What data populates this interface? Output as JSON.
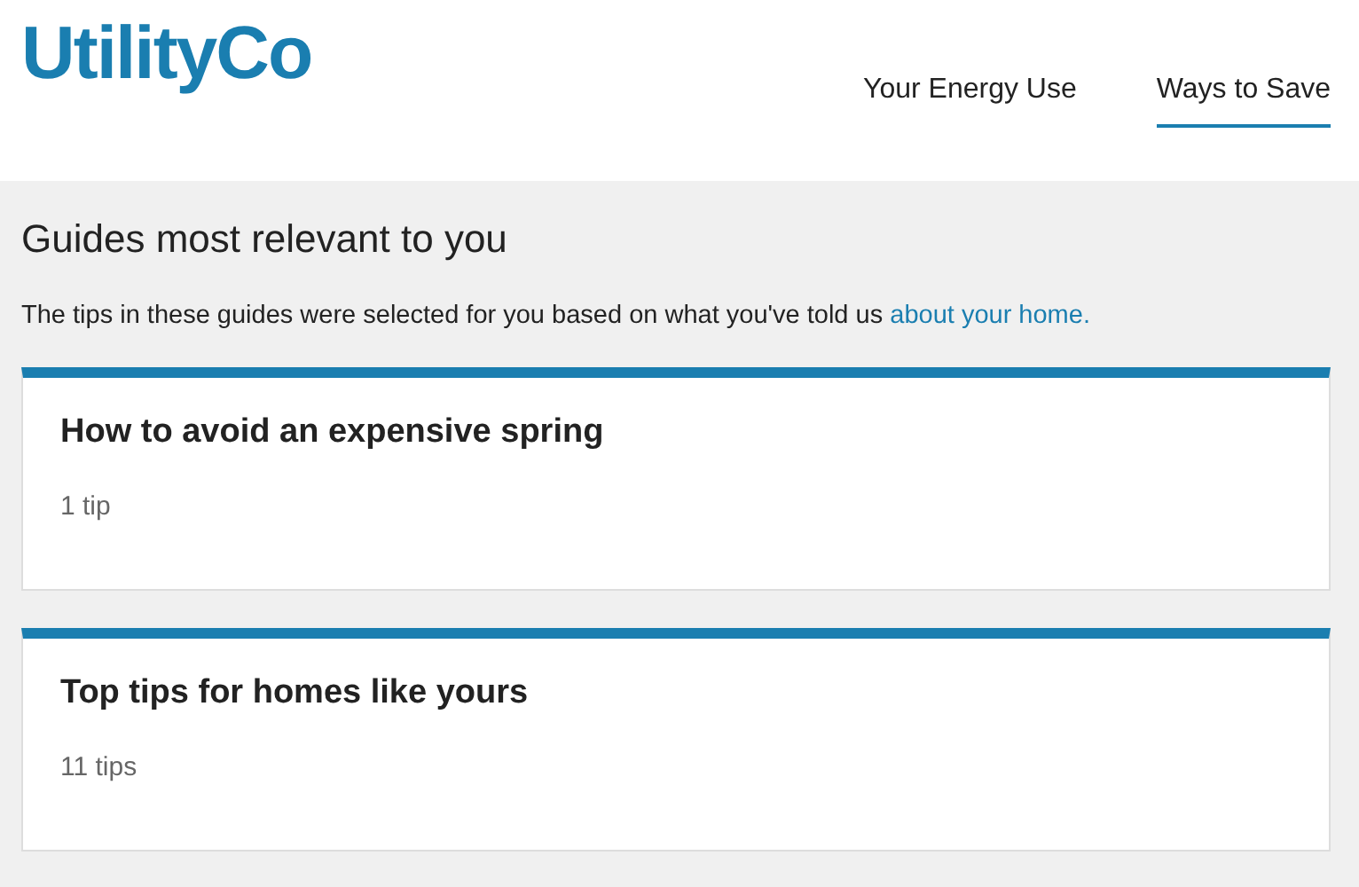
{
  "logo": "UtilityCo",
  "nav": [
    {
      "label": "Your Energy Use",
      "selected": false
    },
    {
      "label": "Ways to Save",
      "selected": true
    }
  ],
  "heading": "Guides most relevant to you",
  "intro": {
    "text": "The tips in these guides were selected for you based on what you've told us ",
    "link": "about your home."
  },
  "guides": [
    {
      "title": "How to avoid an expensive spring",
      "count": "1 tip"
    },
    {
      "title": "Top tips for homes like yours",
      "count": "11 tips"
    }
  ]
}
